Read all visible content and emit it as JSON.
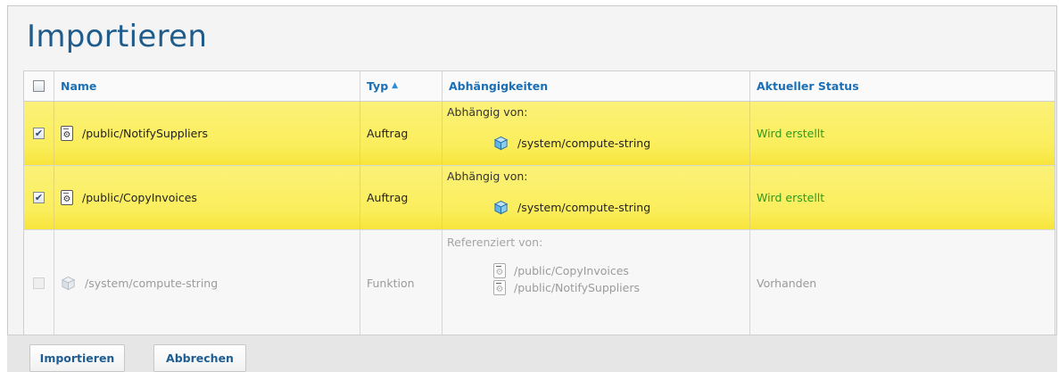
{
  "page": {
    "title": "Importieren"
  },
  "table": {
    "headers": {
      "name": "Name",
      "type": "Typ",
      "dependencies": "Abhängigkeiten",
      "status": "Aktueller Status"
    },
    "rows": [
      {
        "checked": true,
        "icon": "mapping-file-icon",
        "name": "/public/NotifySuppliers",
        "type": "Auftrag",
        "dep_label": "Abhängig von:",
        "deps": [
          "/system/compute-string"
        ],
        "status": "Wird erstellt"
      },
      {
        "checked": true,
        "icon": "mapping-file-icon",
        "name": "/public/CopyInvoices",
        "type": "Auftrag",
        "dep_label": "Abhängig von:",
        "deps": [
          "/system/compute-string"
        ],
        "status": "Wird erstellt"
      },
      {
        "checked": false,
        "disabled": true,
        "icon": "function-cube-icon",
        "name": "/system/compute-string",
        "type": "Funktion",
        "dep_label": "Referenziert von:",
        "deps": [
          "/public/CopyInvoices",
          "/public/NotifySuppliers"
        ],
        "status": "Vorhanden"
      }
    ]
  },
  "actions": {
    "import_label": "Importieren",
    "cancel_label": "Abbrechen"
  },
  "colors": {
    "title": "#1f5c8b",
    "header_text": "#1a6fb6",
    "selected_row": "#fbee5c",
    "status_ok": "#2e9a1e"
  }
}
